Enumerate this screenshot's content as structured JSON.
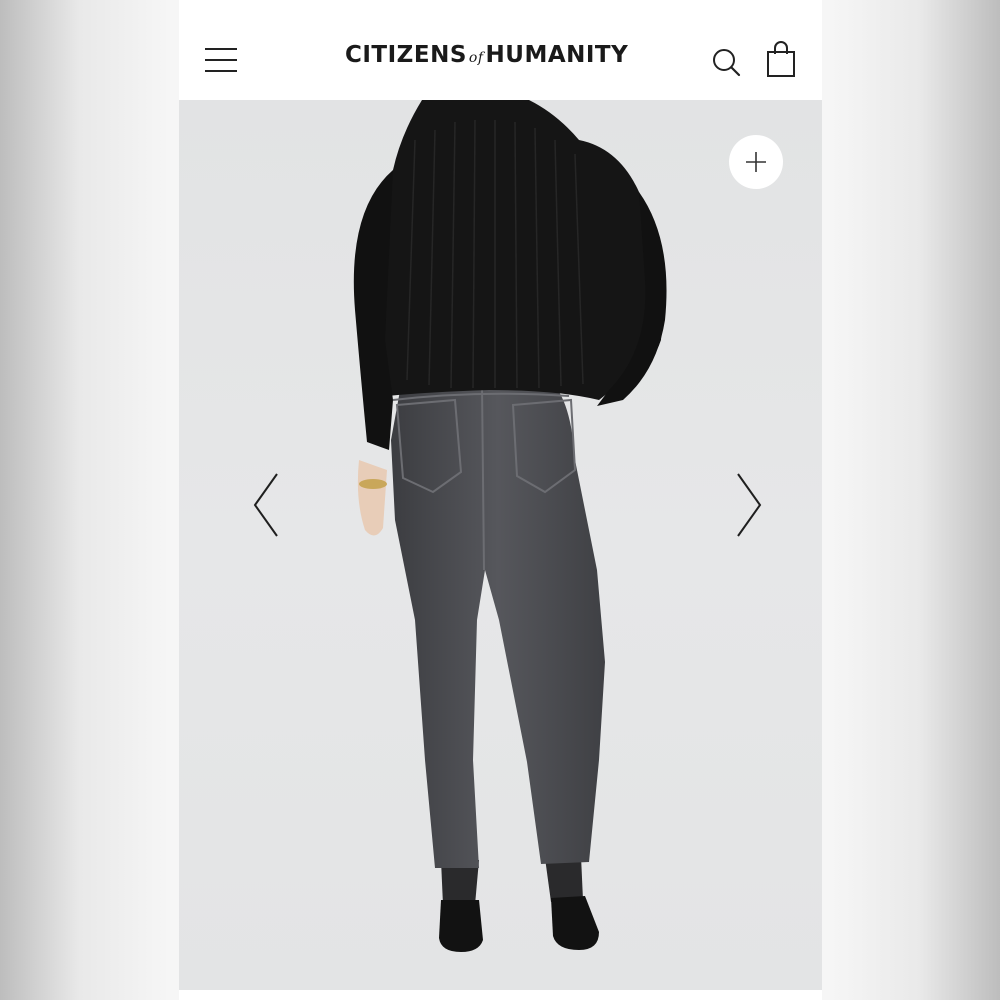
{
  "header": {
    "logo": {
      "part1": "CITIZENS",
      "part2": "of",
      "part3": "HUMANITY"
    },
    "menu_icon": "hamburger-menu-icon",
    "search_icon": "search-icon",
    "bag_icon": "shopping-bag-icon"
  },
  "gallery": {
    "zoom_icon": "plus-icon",
    "prev_icon": "chevron-left-icon",
    "next_icon": "chevron-right-icon",
    "image_subject": "model back view wearing black ribbed sweater and washed black cropped jeans with black mules"
  },
  "colors": {
    "header_bg": "#ffffff",
    "gallery_bg": "#e4e5e6",
    "icon": "#222222",
    "sweater": "#151515",
    "denim": "#4a4b50"
  }
}
